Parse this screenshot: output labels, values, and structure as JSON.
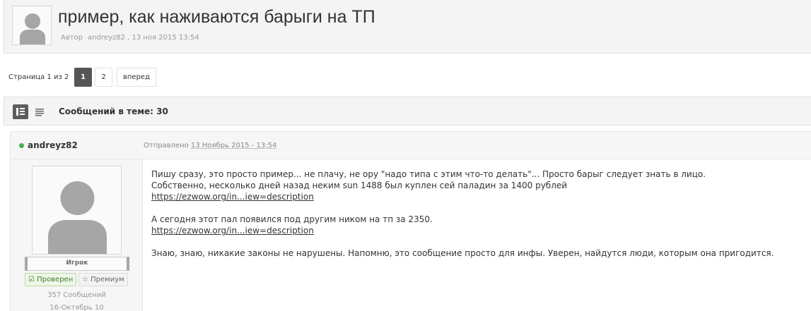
{
  "topic": {
    "title": "пример, как наживаются барыги на ТП",
    "meta_prefix": "Автор",
    "author": "andreyz82",
    "date": ", 13 ноя 2015 13:54"
  },
  "pagination": {
    "info": "Страница 1 из 2",
    "pages": [
      "1",
      "2"
    ],
    "next": "вперед"
  },
  "topic_bar": {
    "count": "Сообщений в теме: 30"
  },
  "post": {
    "author": "andreyz82",
    "date_label": "Отправлено",
    "date_value": "13 Ноябрь 2015 - 13:54",
    "group": "Игрок",
    "badge_verified": "Проверен",
    "badge_premium": "Премиум",
    "messages": "357 Сообщений",
    "joined": "16-Октябрь 10",
    "lines": [
      "Пишу сразу, это просто пример... не плачу, не ору \"надо типа с этим что-то делать\"... Просто барыг следует знать в лицо.",
      "Собственно, несколько дней назад неким sun 1488 был куплен сей паладин за 1400 рублей"
    ],
    "link1": "https://ezwow.org/in...iew=description",
    "line3": "А сегодня этот пал появился под другим ником на тп за 2350.",
    "link2": "https://ezwow.org/in...iew=description",
    "line4": "Знаю, знаю, никакие законы не нарушены. Напомню, это сообщение просто для инфы. Уверен, найдутся люди, которым она пригодится."
  },
  "colors": {
    "online": "#4caf50",
    "verified": "#3d7a28",
    "current_page": "#555555"
  }
}
